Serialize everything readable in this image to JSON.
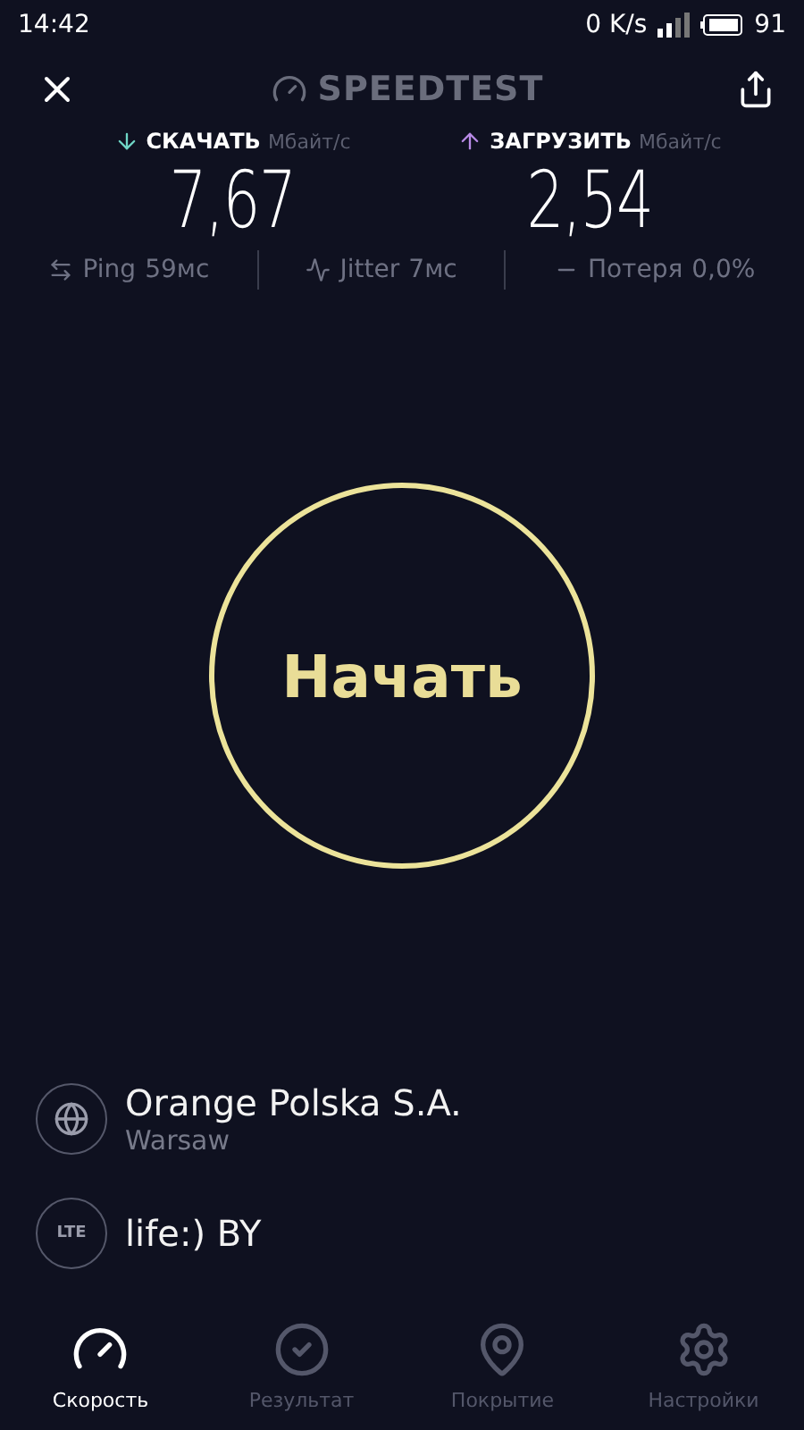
{
  "status_bar": {
    "time": "14:42",
    "net_speed": "0 K/s",
    "battery": "91"
  },
  "header": {
    "title": "SPEEDTEST"
  },
  "speeds": [
    {
      "kind": "download",
      "label": "СКАЧАТЬ",
      "unit": "Мбайт/с",
      "value": "7,67",
      "color": "#6fd6c6"
    },
    {
      "kind": "upload",
      "label": "ЗАГРУЗИТЬ",
      "unit": "Мбайт/с",
      "value": "2,54",
      "color": "#b88ae6"
    }
  ],
  "stats": [
    {
      "kind": "ping",
      "label": "Ping",
      "value": "59мс"
    },
    {
      "kind": "jitter",
      "label": "Jitter",
      "value": "7мс"
    },
    {
      "kind": "loss",
      "label": "Потеря",
      "value": "0,0%"
    }
  ],
  "start_button": {
    "label": "Начать"
  },
  "server": {
    "name": "Orange Polska S.A.",
    "location": "Warsaw"
  },
  "provider": {
    "badge": "LTE",
    "name": "life:) BY"
  },
  "nav": [
    {
      "kind": "speed",
      "label": "Скорость",
      "selected": true
    },
    {
      "kind": "results",
      "label": "Результат",
      "selected": false
    },
    {
      "kind": "coverage",
      "label": "Покрытие",
      "selected": false
    },
    {
      "kind": "settings",
      "label": "Настройки",
      "selected": false
    }
  ]
}
